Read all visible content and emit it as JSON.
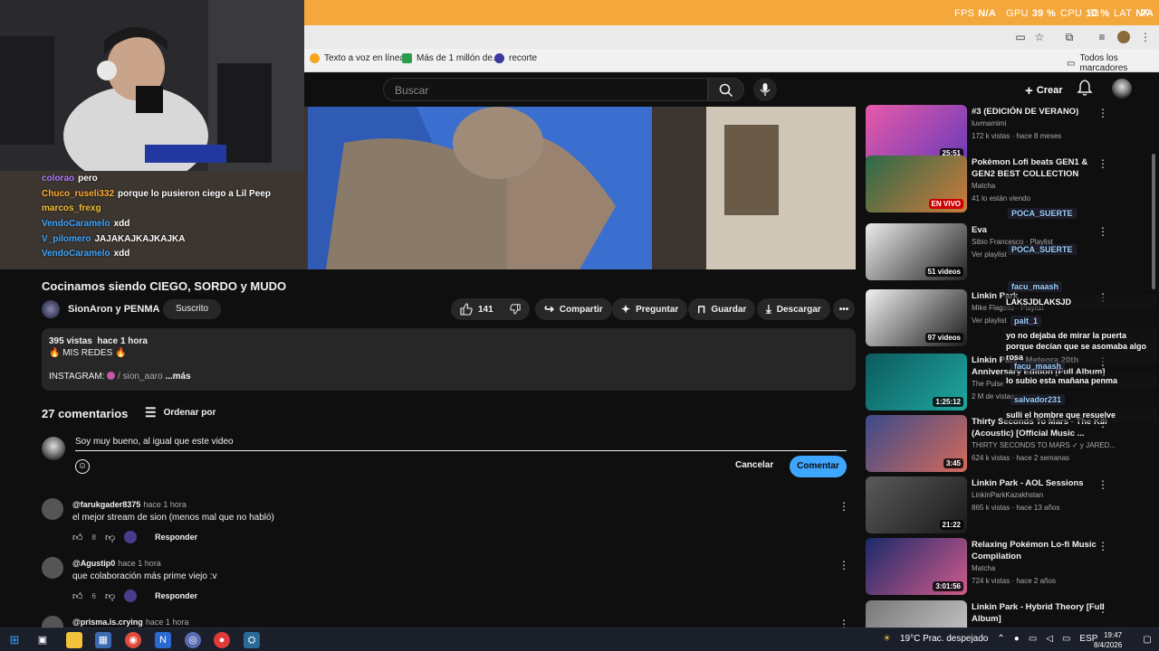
{
  "osd": {
    "fps_label": "FPS",
    "fps_value": "N/A",
    "gpu_label": "GPU",
    "gpu_value": "39 %",
    "cpu_label": "CPU",
    "cpu_value": "10 %",
    "lat_label": "LAT",
    "lat_value": "N/A"
  },
  "bookmarks": {
    "items": [
      "Texto a voz en línea...",
      "Más de 1 millón de...",
      "recorte"
    ],
    "all": "Todos los marcadores"
  },
  "header": {
    "search_placeholder": "Buscar",
    "create_label": "Crear"
  },
  "chat_overlay_left": [
    {
      "user": "colorao",
      "msg": "pero",
      "color": "#b37cff"
    },
    {
      "user": "Chuco_ruseli332",
      "msg": "porque lo pusieron ciego a Lil Peep",
      "color": "#ffae36"
    },
    {
      "user": "marcos_frexg",
      "msg": "",
      "color": "#f1c232"
    },
    {
      "user": "VendoCaramelo",
      "msg": "xdd",
      "color": "#3ea6ff"
    },
    {
      "user": "V_pilomero",
      "msg": "JAJAKAJKAJKAJKA",
      "color": "#3ea6ff"
    },
    {
      "user": "VendoCaramelo",
      "msg": "xdd",
      "color": "#3ea6ff"
    }
  ],
  "video": {
    "title": "Cocinamos siendo CIEGO, SORDO y MUDO",
    "channel": "SionAron y PENMA",
    "subscribed_label": "Suscrito",
    "likes": "141",
    "share": "Compartir",
    "ask": "Preguntar",
    "save": "Guardar",
    "download": "Descargar"
  },
  "description": {
    "views": "395 vistas",
    "time": "hace 1 hora",
    "line1": "🔥 MIS REDES 🔥",
    "line2": "INSTAGRAM:",
    "handle": "/ sion_aaro",
    "more": "...más"
  },
  "comments": {
    "count_label": "27 comentarios",
    "sort_label": "Ordenar por",
    "draft": "Soy muy bueno, al igual que este video",
    "cancel": "Cancelar",
    "submit": "Comentar",
    "reply_label": "Responder",
    "items": [
      {
        "author": "@farukgader8375",
        "time": "hace 1 hora",
        "text": "el mejor stream de sion (menos mal que no habló)",
        "likes": "8"
      },
      {
        "author": "@Agustip0",
        "time": "hace 1 hora",
        "text": "que colaboración más prime viejo :v",
        "likes": "6"
      },
      {
        "author": "@prisma.is.crying",
        "time": "hace 1 hora",
        "text": "",
        "likes": ""
      }
    ]
  },
  "recommendations": [
    {
      "title": "#3 (EDICIÓN DE VERANO)",
      "channel": "luvmamimi",
      "meta": "172 k vistas · hace 8 meses",
      "badge": "25:51",
      "colors": [
        "#e85aa8",
        "#6a3bb8"
      ]
    },
    {
      "title": "Pokèmon Lofi beats GEN1 & GEN2 BEST COLLECTION",
      "channel": "Matcha",
      "meta": "41 lo están viendo",
      "badge": "EN VIVO",
      "colors": [
        "#2a6a4a",
        "#d07a3a"
      ]
    },
    {
      "title": "Eva",
      "channel": "Sibio Francesco · Playlist",
      "meta": "Ver playlist",
      "badge": "51 videos",
      "colors": [
        "#ececec",
        "#222222"
      ]
    },
    {
      "title": "Linkin Park",
      "channel": "Mike Flagello · Playlist",
      "meta": "Ver playlist",
      "badge": "97 videos",
      "colors": [
        "#f2f2f2",
        "#1a1a1a"
      ]
    },
    {
      "title": "Linkin Park - Meteora 20th Anniversary Edition [Full Album]",
      "channel": "The Pulse",
      "meta": "2 M de vistas",
      "badge": "1:25:12",
      "colors": [
        "#0c5a5e",
        "#1fa7a0"
      ]
    },
    {
      "title": "Thirty Seconds To Mars - The Kill (Acoustic) [Official Music ...",
      "channel": "THIRTY SECONDS TO MARS ✓ y JARED...",
      "meta": "624 k vistas · hace 2 semanas",
      "badge": "3:45",
      "colors": [
        "#3b4a8a",
        "#d46a5a"
      ]
    },
    {
      "title": "Linkin Park - AOL Sessions",
      "channel": "LinkinParkKazakhstan",
      "meta": "865 k vistas · hace 13 años",
      "badge": "21:22",
      "colors": [
        "#5a5a5a",
        "#1a1a1a"
      ]
    },
    {
      "title": "Relaxing Pokémon Lo-fi Music Compilation",
      "channel": "Matcha",
      "meta": "724 k vistas · hace 2 años",
      "badge": "3:01:56",
      "colors": [
        "#1b2a6a",
        "#d05a8a"
      ]
    },
    {
      "title": "Linkin Park - Hybrid Theory [Full Album]",
      "channel": "",
      "meta": "",
      "badge": "",
      "colors": [
        "#777777",
        "#cfcfcf"
      ]
    }
  ],
  "chat_overlay_right": [
    {
      "kind": "name",
      "text": "POCA_SUERTE"
    },
    {
      "kind": "name",
      "text": "POCA_SUERTE"
    },
    {
      "kind": "name",
      "text": "facu_maash"
    },
    {
      "kind": "msg",
      "text": "LAKSJDLAKSJD"
    },
    {
      "kind": "name",
      "text": "palt_1"
    },
    {
      "kind": "msg",
      "text": "yo no dejaba de mirar la puerta porque decían que se asomaba algo rosa"
    },
    {
      "kind": "name",
      "text": "facu_maash"
    },
    {
      "kind": "msg",
      "text": "lo subio esta mañana penma"
    },
    {
      "kind": "name",
      "text": "salvador231"
    },
    {
      "kind": "msg",
      "text": "sulli el hombre que resuelve"
    }
  ],
  "taskbar": {
    "weather": "19°C  Prac. despejado",
    "lang": "ESP",
    "time": "19:47",
    "date": "8/4/2026"
  }
}
